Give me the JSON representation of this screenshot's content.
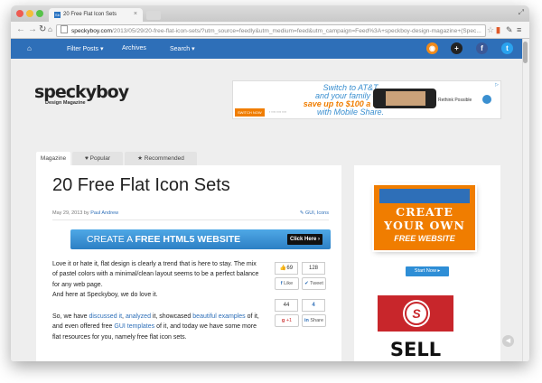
{
  "browser": {
    "tab_title": "20 Free Flat Icon Sets",
    "tab_favicon": "Sb",
    "url_host": "speckyboy.com",
    "url_path": "/2013/05/29/20-free-flat-icon-sets/?utm_source=feedly&utm_medium=feed&utm_campaign=Feed%3A+speckboy-design-magazine+(Spec..."
  },
  "site_nav": {
    "home_icon": "home-icon",
    "items": [
      "Filter Posts ▾",
      "Archives",
      "Search ▾"
    ]
  },
  "logo": {
    "main": "speckyboy",
    "sub": "Design Magazine"
  },
  "ad_banner": {
    "line1": "Switch to AT&T",
    "line2": "and your family can",
    "line3": "save up to $100 a month",
    "line4": "with Mobile Share.",
    "switch_label": "SWITCH NOW",
    "rethink": "Rethink Possible"
  },
  "page_tabs": [
    "Magazine",
    "♥ Popular",
    "★ Recommended"
  ],
  "article": {
    "title": "20 Free Flat Icon Sets",
    "date": "May 29, 2013 by ",
    "author": "Paul Andrew",
    "tags": "✎ GUI, Icons",
    "banner_text_a": "CREATE A ",
    "banner_text_b": "FREE HTML5 WEBSITE",
    "banner_button": "Click Here ›",
    "p1": "Love it or hate it, flat design is clearly a trend that is here to stay. The mix of pastel colors with a minimal/clean layout seems to be a perfect balance for any web page.",
    "p1b": "And here at Speckyboy, we do love it.",
    "p2_a": "So, we have ",
    "p2_link1": "discussed it",
    "p2_b": ", ",
    "p2_link2": "analyzed",
    "p2_c": " it, showcased ",
    "p2_link3": "beautiful examples",
    "p2_d": " of it, and even offered free ",
    "p2_link4": "GUI templates",
    "p2_e": " of it, and today we have some more flat resources for you, namely free flat icon sets."
  },
  "share": {
    "likes": "69",
    "tweets": "128",
    "plus": "44",
    "shares": "4",
    "like_label": "Like",
    "tweet_label": "Tweet",
    "plus_label": "+1",
    "share_label": "Share"
  },
  "sidebar": {
    "ad1_l1": "CREATE",
    "ad1_l2": "YOUR OWN",
    "ad1_l3": "FREE WEBSITE",
    "start_button": "Start Now ▸",
    "ad2_mark": "S",
    "ad2_text": "SELL"
  }
}
